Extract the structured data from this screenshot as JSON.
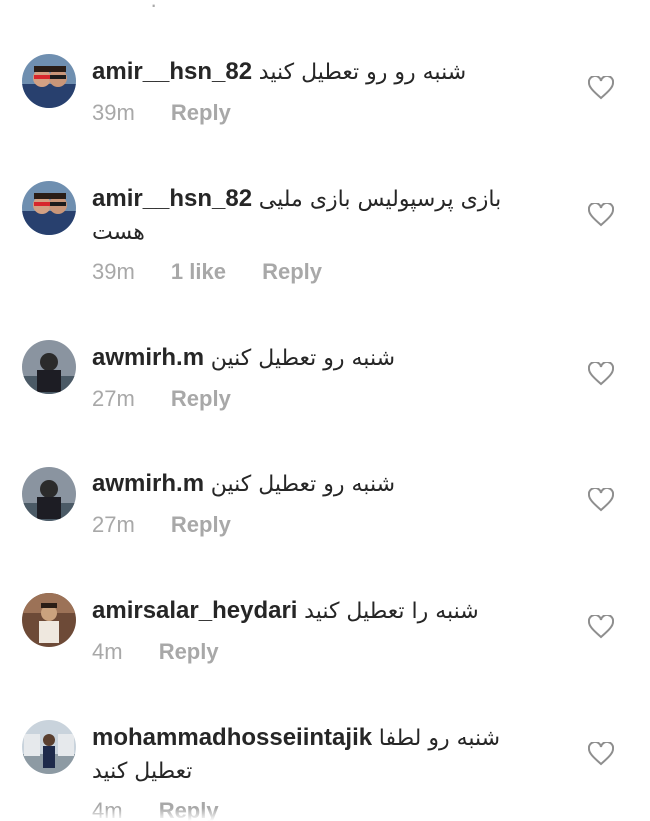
{
  "comments": [
    {
      "username": "amir__hsn_82",
      "text": "شنبه رو رو تعطیل کنید",
      "text_cont": "",
      "time": "39m",
      "likes": "",
      "reply": "Reply"
    },
    {
      "username": "amir__hsn_82",
      "text": "بازی پرسپولیس بازی ملیی",
      "text_cont": "هست",
      "time": "39m",
      "likes": "1 like",
      "reply": "Reply"
    },
    {
      "username": "awmirh.m",
      "text": "شنبه رو تعطیل کنین",
      "text_cont": "",
      "time": "27m",
      "likes": "",
      "reply": "Reply"
    },
    {
      "username": "awmirh.m",
      "text": "شنبه رو تعطیل کنین",
      "text_cont": "",
      "time": "27m",
      "likes": "",
      "reply": "Reply"
    },
    {
      "username": "amirsalar_heydari",
      "text": "شنبه را تعطیل کنید",
      "text_cont": "",
      "time": "4m",
      "likes": "",
      "reply": "Reply"
    },
    {
      "username": "mohammadhosseiintajik",
      "text": "شنبه رو لطفا",
      "text_cont": "تعطیل کنید",
      "time": "4m",
      "likes": "",
      "reply": "Reply"
    }
  ],
  "icons": {
    "like": "heart-outline-icon"
  }
}
